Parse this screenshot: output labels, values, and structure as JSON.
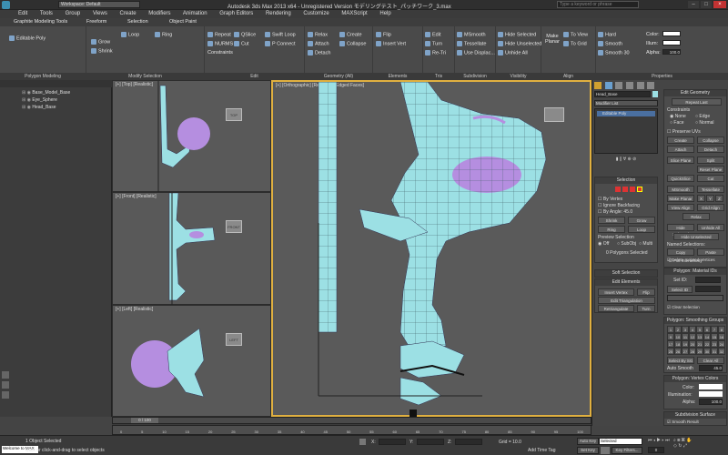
{
  "title": {
    "app": "Autodesk 3ds Max  2013 x64  -  Unregistered Version    モデリングテスト_パッチワーク_3.max",
    "workspace": "Workspace: Default",
    "search_placeholder": "Type a keyword or phrase"
  },
  "menu": [
    "Edit",
    "Tools",
    "Group",
    "Views",
    "Create",
    "Modifiers",
    "Animation",
    "Graph Editors",
    "Rendering",
    "Customize",
    "MAXScript",
    "Help"
  ],
  "ribbon": {
    "tabs": [
      "Graphite Modeling Tools",
      "Freeform",
      "Selection",
      "Object Paint"
    ],
    "sections": {
      "polygon_modeling": "Polygon Modeling",
      "modify_selection": "Modify Selection",
      "edit": "Edit",
      "geometry": "Geometry (All)",
      "elements": "Elements",
      "tris": "Tris",
      "subdivision": "Subdivision",
      "visibility": "Visibility",
      "align": "Align",
      "properties": "Properties"
    },
    "editable_poly": "Editable Poly",
    "modify_items": [
      "Grow",
      "Shrink",
      "Loop",
      "Ring"
    ],
    "edit_items": [
      "Repeat",
      "NURMS",
      "Constraints",
      "QSlice",
      "Cut",
      "Swift Loop",
      "P Connect"
    ],
    "geometry_items": [
      "Relax",
      "Attach",
      "Detach",
      "Create",
      "Collapse"
    ],
    "element_items": [
      "Flip",
      "Insert Vert"
    ],
    "tris_items": [
      "Edit",
      "Turn",
      "Re-Tri"
    ],
    "subdiv_items": [
      "MSmooth",
      "Tessellate",
      "Use Displac..."
    ],
    "visibility_items": [
      "Hide Selected",
      "Hide Unselected",
      "Unhide All"
    ],
    "align_items": [
      "Make Planar",
      "To View",
      "To Grid"
    ],
    "properties_items": [
      "Hard",
      "Smooth",
      "Smooth 30"
    ],
    "color_label": "Color:",
    "illum_label": "Illum:",
    "alpha_label": "Alpha:",
    "alpha_value": "100.0"
  },
  "scene": {
    "items": [
      "Base_Model_Base",
      "Eye_Sphere",
      "Head_Base"
    ]
  },
  "viewports": {
    "top": "[+] [Top] [Realistic]",
    "front": "[+] [Front] [Realistic]",
    "left": "[+] [Left] [Realistic]",
    "ortho": "[+] [Orthographic] [Realistic + Edged Faces]",
    "cube_top": "TOP",
    "cube_front": "FRONT",
    "cube_left": "LEFT"
  },
  "panel": {
    "object_name": "Head_Base",
    "modifier_list": "Modifier List",
    "stack_item": "Editable Poly",
    "edit_geometry": "Edit Geometry",
    "repeat_last": "Repeat Last",
    "constraints": "Constraints",
    "constraint_opts": [
      "None",
      "Edge",
      "Face",
      "Normal"
    ],
    "preserve_uvs": "Preserve UVs",
    "create": "Create",
    "collapse": "Collapse",
    "attach": "Attach",
    "detach": "Detach",
    "slice_plane": "Slice Plane",
    "split": "Split",
    "reset_plane": "Reset Plane",
    "quickslice": "QuickSlice",
    "cut": "Cut",
    "msmooth": "MSmooth",
    "tessellate": "Tessellate",
    "make_planar": "Make Planar",
    "xyz": [
      "X",
      "Y",
      "Z"
    ],
    "view_align": "View Align",
    "grid_align": "Grid Align",
    "relax": "Relax",
    "hide_selected": "Hide Selected",
    "unhide_all": "Unhide All",
    "hide_unselected": "Hide Unselected",
    "named_selections": "Named Selections:",
    "copy": "Copy",
    "paste": "Paste",
    "delete_isolated": "Delete Isolated Vertices",
    "full_interactivity": "Full Interactivity",
    "selection": "Selection",
    "by_vertex": "By Vertex",
    "ignore_backfacing": "Ignore Backfacing",
    "by_angle": "By Angle:",
    "by_angle_value": "45.0",
    "shrink": "Shrink",
    "grow": "Grow",
    "ring": "Ring",
    "loop": "Loop",
    "preview_selection": "Preview Selection",
    "preview_opts": [
      "Off",
      "SubObj",
      "Multi"
    ],
    "poly_selected": "0 Polygons Selected",
    "soft_selection": "Soft Selection",
    "edit_elements": "Edit Elements",
    "insert_vertex": "Insert Vertex",
    "flip": "Flip",
    "edit_triangulation": "Edit Triangulation",
    "retriangulate": "Retriangulate",
    "turn": "Turn",
    "material_ids": "Polygon: Material IDs",
    "set_id": "Set ID:",
    "select_id": "Select ID",
    "clear_selection": "Clear Selection",
    "smoothing_groups": "Polygon: Smoothing Groups",
    "sg_numbers": [
      "1",
      "2",
      "3",
      "4",
      "5",
      "6",
      "7",
      "8",
      "9",
      "10",
      "11",
      "12",
      "13",
      "14",
      "15",
      "16",
      "17",
      "18",
      "19",
      "20",
      "21",
      "22",
      "23",
      "24",
      "25",
      "26",
      "27",
      "28",
      "29",
      "30",
      "31",
      "32"
    ],
    "select_by_sg": "Select By SG",
    "clear_all": "Clear All",
    "auto_smooth": "Auto Smooth",
    "auto_smooth_value": "45.0",
    "vertex_colors": "Polygon: Vertex Colors",
    "color": "Color:",
    "illumination": "Illumination:",
    "alpha": "Alpha:",
    "alpha_value": "100.0",
    "subdivision_surface": "Subdivision Surface",
    "smooth_result": "Smooth Result"
  },
  "timeline": {
    "frame": "0 / 100",
    "ticks": [
      "0",
      "5",
      "10",
      "15",
      "20",
      "25",
      "30",
      "35",
      "40",
      "45",
      "50",
      "55",
      "60",
      "65",
      "70",
      "75",
      "80",
      "85",
      "90",
      "95",
      "100"
    ]
  },
  "status": {
    "welcome": "Welcome to MAX",
    "selected": "1 Object Selected",
    "hint": "Click or click-and-drag to select objects",
    "x_label": "X:",
    "y_label": "Y:",
    "z_label": "Z:",
    "grid": "Grid = 10.0",
    "add_time_tag": "Add Time Tag",
    "auto_key": "Auto Key",
    "set_key": "Set Key",
    "selected_dropdown": "Selected",
    "key_filters": "Key Filters...",
    "frame_value": "0"
  }
}
